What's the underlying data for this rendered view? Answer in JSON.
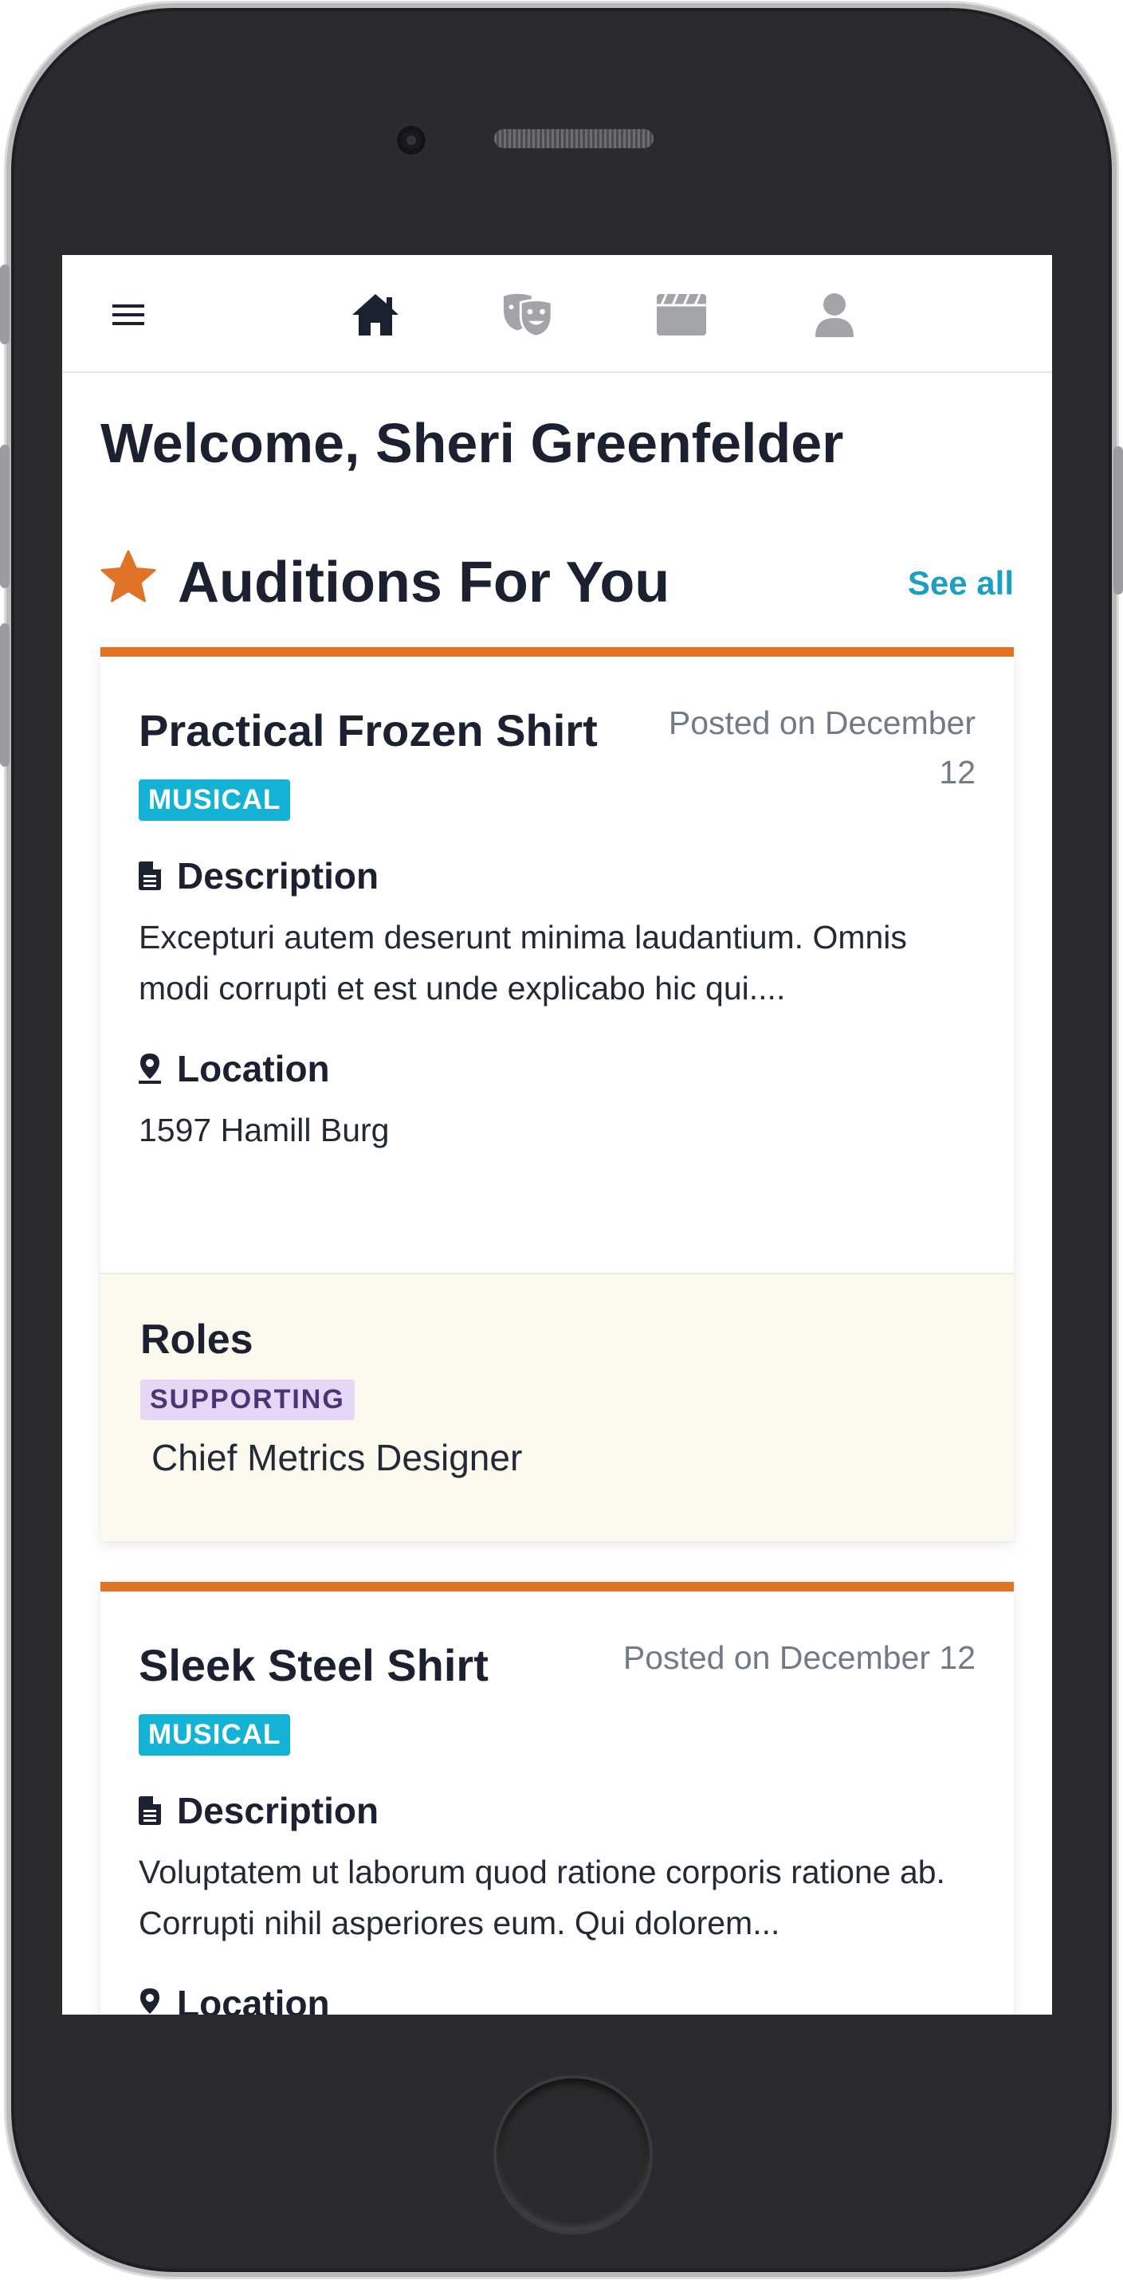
{
  "nav": {
    "menu_icon": "hamburger-icon",
    "items": [
      {
        "icon": "home-icon",
        "active": true
      },
      {
        "icon": "theater-masks-icon",
        "active": false
      },
      {
        "icon": "clapperboard-icon",
        "active": false
      },
      {
        "icon": "user-icon",
        "active": false
      }
    ]
  },
  "welcome": "Welcome, Sheri Greenfelder",
  "section": {
    "icon": "star-icon",
    "title": "Auditions For You",
    "see_all": "See all"
  },
  "auditions": [
    {
      "title": "Practical Frozen Shirt",
      "posted": "Posted on December 12",
      "type": "MUSICAL",
      "description_label": "Description",
      "description": "Excepturi autem deserunt minima laudantium. Omnis modi corrupti et est unde explicabo hic qui....",
      "location_label": "Location",
      "location": "1597 Hamill Burg",
      "roles_label": "Roles",
      "role_badge": "SUPPORTING",
      "role_name": "Chief Metrics Designer"
    },
    {
      "title": "Sleek Steel Shirt",
      "posted": "Posted on December 12",
      "type": "MUSICAL",
      "description_label": "Description",
      "description": "Voluptatem ut laborum quod ratione corporis ratione ab. Corrupti nihil asperiores eum. Qui dolorem...",
      "location_label": "Location"
    }
  ],
  "colors": {
    "accent": "#e07326",
    "link": "#1d9fc4",
    "badge_type": "#14b3d6",
    "badge_role_bg": "#e6d7f6",
    "roles_bg": "#fcf9ee",
    "text": "#1b2130",
    "muted": "#717b88"
  }
}
